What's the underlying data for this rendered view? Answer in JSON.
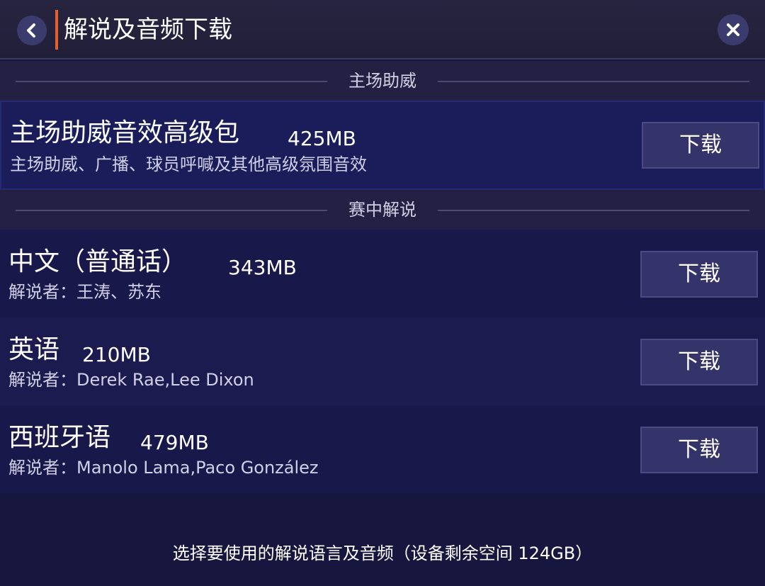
{
  "header": {
    "title": "解说及音频下载",
    "back_icon": "chevron-left-icon",
    "close_icon": "close-icon"
  },
  "sections": {
    "home_support": {
      "label": "主场助威",
      "item": {
        "name": "主场助威音效高级包",
        "size": "425MB",
        "description": "主场助威、广播、球员呼喊及其他高级氛围音效",
        "button": "下载"
      }
    },
    "commentary": {
      "label": "赛中解说",
      "items": [
        {
          "name": "中文（普通话）",
          "size": "343MB",
          "description": "解说者：王涛、苏东",
          "button": "下载"
        },
        {
          "name": "英语",
          "size": "210MB",
          "description": "解说者：Derek Rae,Lee Dixon",
          "button": "下载"
        },
        {
          "name": "西班牙语",
          "size": "479MB",
          "description": "解说者：Manolo Lama,Paco González",
          "button": "下载"
        }
      ]
    }
  },
  "footer": {
    "text": "选择要使用的解说语言及音频（设备剩余空间 124GB）"
  },
  "colors": {
    "background": "#16163f",
    "accent": "#e4612c",
    "button": "#34346a",
    "icon_circle": "#3c3b6e"
  }
}
